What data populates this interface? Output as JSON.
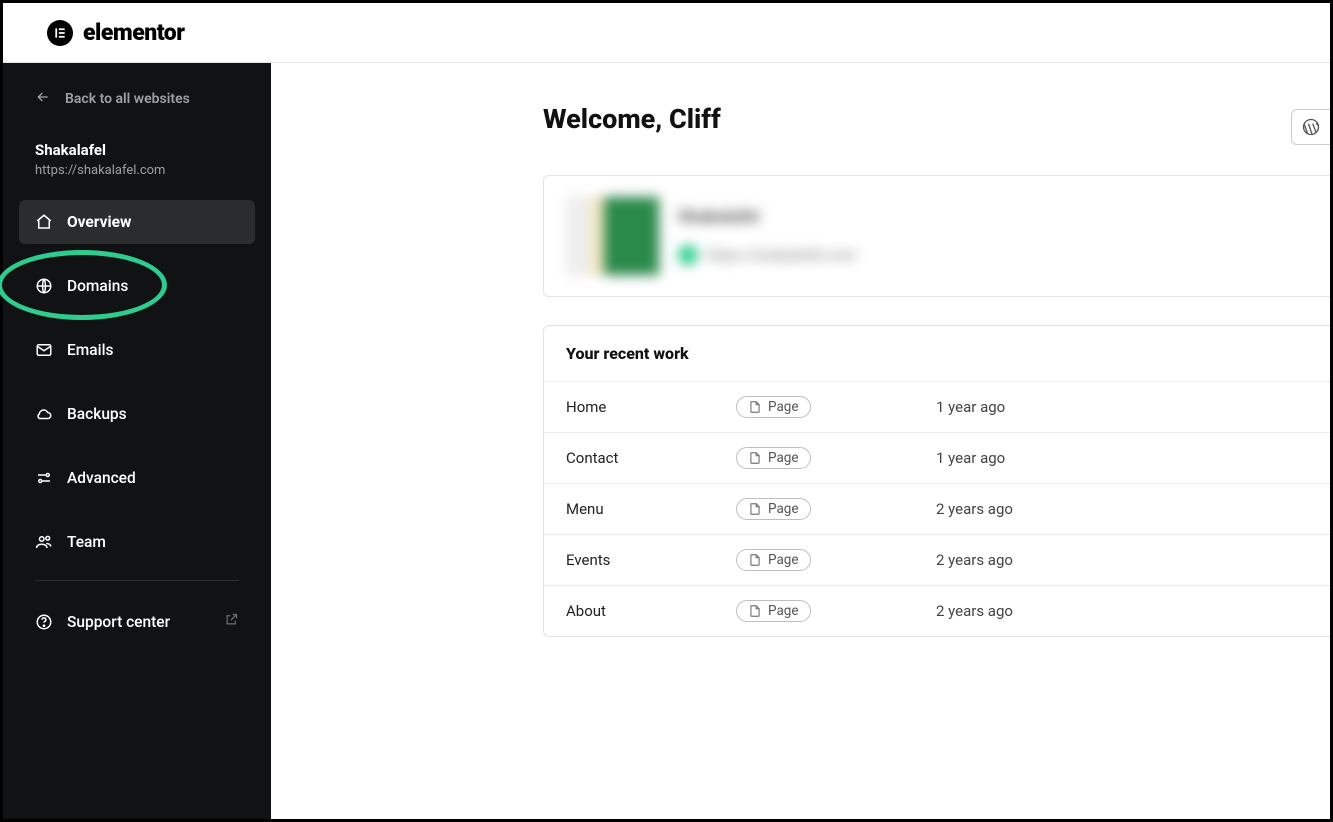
{
  "brand": {
    "name": "elementor",
    "icon_label": "E"
  },
  "sidebar": {
    "back_label": "Back to all websites",
    "site_name": "Shakalafel",
    "site_url": "https://shakalafel.com",
    "items": [
      {
        "label": "Overview"
      },
      {
        "label": "Domains"
      },
      {
        "label": "Emails"
      },
      {
        "label": "Backups"
      },
      {
        "label": "Advanced"
      },
      {
        "label": "Team"
      }
    ],
    "support_label": "Support center"
  },
  "main": {
    "title": "Welcome, Cliff",
    "site_card": {
      "title": "Shakalafel",
      "url": "https://shakalafel.com"
    },
    "recent_header": "Your recent work",
    "type_label": "Page",
    "rows": [
      {
        "name": "Home",
        "time": "1 year ago"
      },
      {
        "name": "Contact",
        "time": "1 year ago"
      },
      {
        "name": "Menu",
        "time": "2 years ago"
      },
      {
        "name": "Events",
        "time": "2 years ago"
      },
      {
        "name": "About",
        "time": "2 years ago"
      }
    ]
  }
}
